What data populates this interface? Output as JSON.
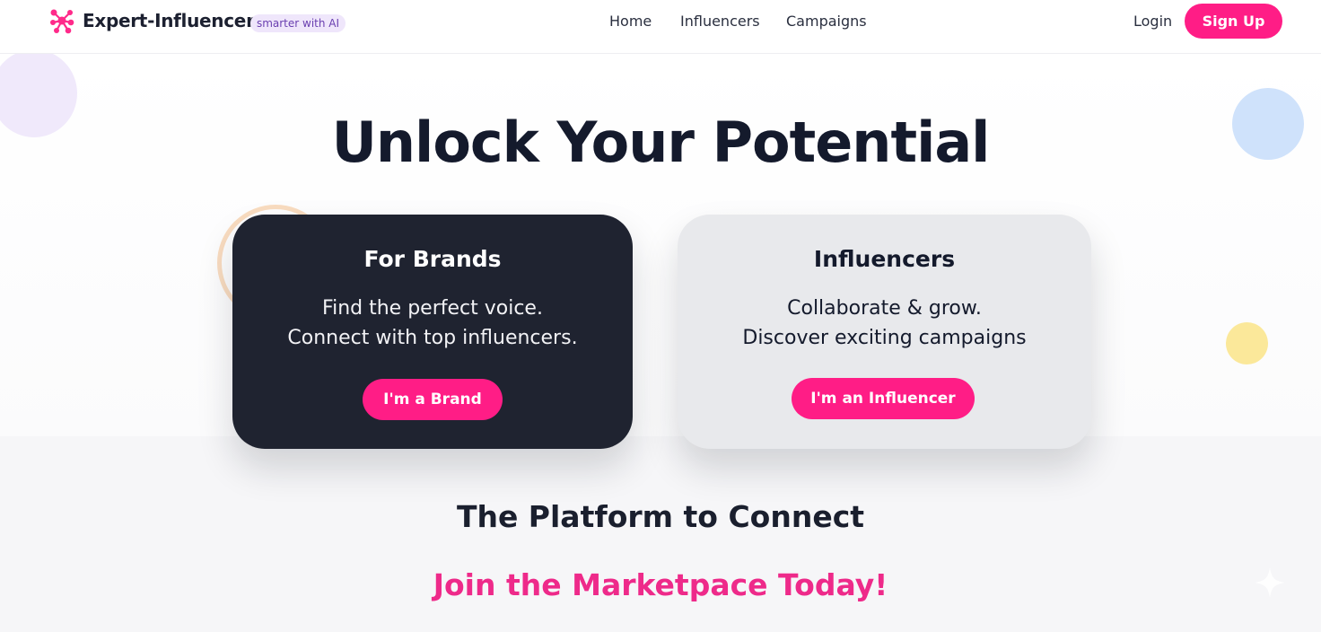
{
  "header": {
    "brand": "Expert-Influencer",
    "tag": "smarter with AI",
    "nav": [
      "Home",
      "Influencers",
      "Campaigns"
    ],
    "login": "Login",
    "signup": "Sign Up"
  },
  "hero": {
    "title": "Unlock Your Potential"
  },
  "cards": {
    "brands": {
      "title": "For Brands",
      "line1": "Find the perfect voice.",
      "line2": "Connect with top influencers.",
      "button": "I'm a Brand"
    },
    "influencers": {
      "title": "Influencers",
      "line1": "Collaborate & grow.",
      "line2": "Discover exciting campaigns",
      "button": "I'm an Influencer"
    }
  },
  "section": {
    "platform": "The Platform to Connect",
    "join": "Join the Marketpace Today!"
  },
  "colors": {
    "accent": "#ff1d86",
    "dark_card": "#1f2330",
    "light_card": "#e8e9ec",
    "join_text": "#ee2a8a"
  },
  "icons": {
    "logo": "molecule-logo-icon",
    "decor": "sparkle-icon"
  }
}
